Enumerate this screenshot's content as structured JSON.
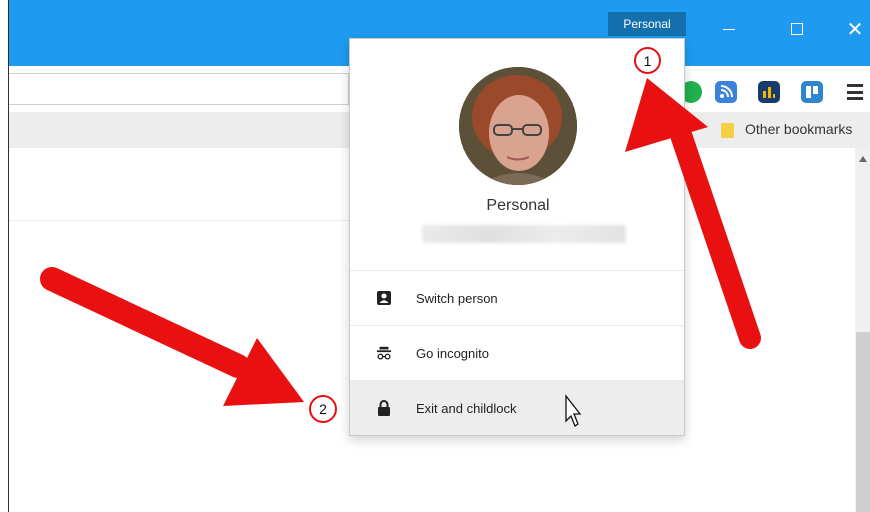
{
  "titlebar": {
    "profile_button": "Personal",
    "close_glyph": "✕"
  },
  "bookmarks_bar": {
    "other_bookmarks": "Other bookmarks"
  },
  "profile_menu": {
    "name": "Personal",
    "items": [
      {
        "label": "Switch person",
        "icon": "switch-person-icon"
      },
      {
        "label": "Go incognito",
        "icon": "incognito-icon"
      },
      {
        "label": "Exit and childlock",
        "icon": "lock-icon"
      }
    ]
  },
  "callouts": [
    {
      "number": "1"
    },
    {
      "number": "2"
    }
  ],
  "colors": {
    "titlebar": "#1e9bf0",
    "profile_button": "#1370ad",
    "arrow": "#e81010",
    "menu_hover": "#ededed"
  }
}
